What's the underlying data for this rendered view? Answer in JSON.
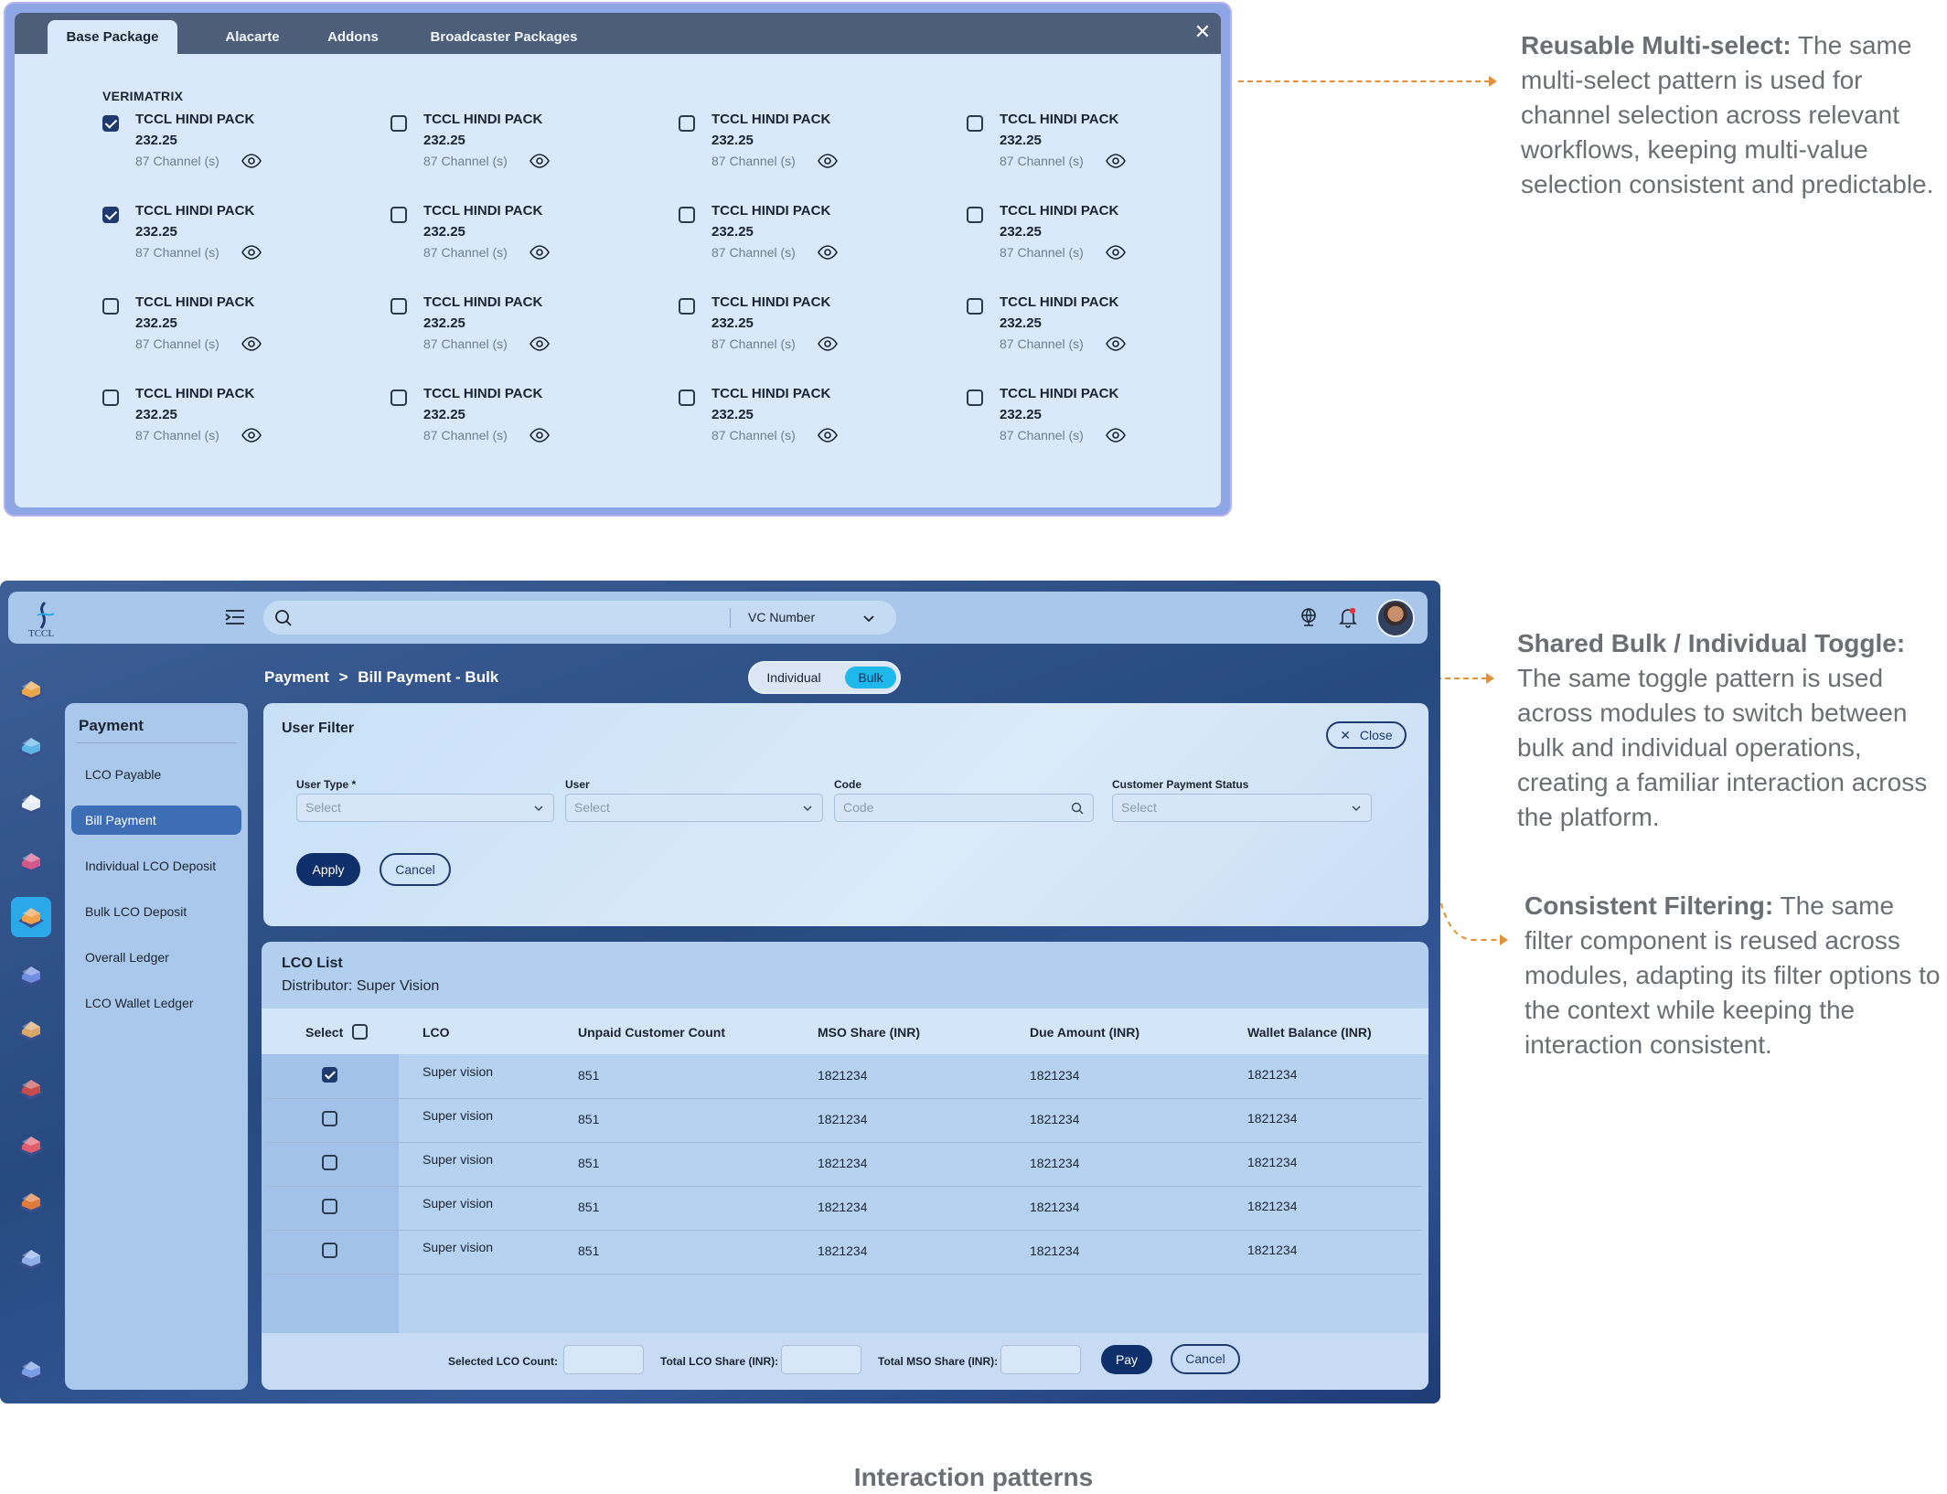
{
  "package_panel": {
    "tabs": [
      "Base Package",
      "Alacarte",
      "Addons",
      "Broadcaster Packages"
    ],
    "active_tab": 0,
    "close_icon": "close-icon",
    "vendor": "VERIMATRIX",
    "packs": [
      {
        "name": "TCCL HINDI PACK",
        "price": "232.25",
        "channels": "87 Channel (s)",
        "checked": true
      },
      {
        "name": "TCCL HINDI PACK",
        "price": "232.25",
        "channels": "87 Channel (s)",
        "checked": false
      },
      {
        "name": "TCCL HINDI PACK",
        "price": "232.25",
        "channels": "87 Channel (s)",
        "checked": false
      },
      {
        "name": "TCCL HINDI PACK",
        "price": "232.25",
        "channels": "87 Channel (s)",
        "checked": false
      },
      {
        "name": "TCCL HINDI PACK",
        "price": "232.25",
        "channels": "87 Channel (s)",
        "checked": true
      },
      {
        "name": "TCCL HINDI PACK",
        "price": "232.25",
        "channels": "87 Channel (s)",
        "checked": false
      },
      {
        "name": "TCCL HINDI PACK",
        "price": "232.25",
        "channels": "87 Channel (s)",
        "checked": false
      },
      {
        "name": "TCCL HINDI PACK",
        "price": "232.25",
        "channels": "87 Channel (s)",
        "checked": false
      },
      {
        "name": "TCCL HINDI PACK",
        "price": "232.25",
        "channels": "87 Channel (s)",
        "checked": false
      },
      {
        "name": "TCCL HINDI PACK",
        "price": "232.25",
        "channels": "87 Channel (s)",
        "checked": false
      },
      {
        "name": "TCCL HINDI PACK",
        "price": "232.25",
        "channels": "87 Channel (s)",
        "checked": false
      },
      {
        "name": "TCCL HINDI PACK",
        "price": "232.25",
        "channels": "87 Channel (s)",
        "checked": false
      },
      {
        "name": "TCCL HINDI PACK",
        "price": "232.25",
        "channels": "87 Channel (s)",
        "checked": false
      },
      {
        "name": "TCCL HINDI PACK",
        "price": "232.25",
        "channels": "87 Channel (s)",
        "checked": false
      },
      {
        "name": "TCCL HINDI PACK",
        "price": "232.25",
        "channels": "87 Channel (s)",
        "checked": false
      },
      {
        "name": "TCCL HINDI PACK",
        "price": "232.25",
        "channels": "87 Channel (s)",
        "checked": false
      }
    ]
  },
  "annotations": [
    {
      "title": "Reusable Multi-select:",
      "body": "The same multi-select pattern is used for channel selection across relevant workflows, keeping multi-value selection consistent and predictable."
    },
    {
      "title": "Shared Bulk / Individual Toggle:",
      "body": "The same toggle pattern is used across modules to switch between bulk and individual operations, creating a familiar interaction across the platform."
    },
    {
      "title": "Consistent Filtering:",
      "body": "The same filter component is reused across modules, adapting its filter options to the context while keeping the interaction consistent."
    }
  ],
  "caption": "Interaction patterns",
  "app": {
    "logo_text": "TCCL",
    "search": {
      "placeholder": "",
      "dropdown_value": "VC Number"
    },
    "header_icons": [
      "globe-icon",
      "bell-icon",
      "avatar"
    ],
    "rail_icons": [
      "house-icon",
      "user-icon",
      "card-icon",
      "person-icon",
      "payment-icon",
      "team-icon",
      "box-icon",
      "tv-icon",
      "offer-icon",
      "report-icon",
      "document-icon",
      "settings-icon"
    ],
    "active_rail_index": 4,
    "side_menu": {
      "title": "Payment",
      "items": [
        "LCO Payable",
        "Bill Payment",
        "Individual LCO Deposit",
        "Bulk LCO Deposit",
        "Overall Ledger",
        "LCO Wallet Ledger"
      ],
      "active_index": 1
    },
    "breadcrumb": {
      "parent": "Payment",
      "separator": ">",
      "current": "Bill Payment - Bulk"
    },
    "toggle": {
      "individual": "Individual",
      "bulk": "Bulk",
      "active": "Bulk"
    },
    "filter": {
      "title": "User Filter",
      "close_label": "Close",
      "fields": [
        {
          "label": "User Type *",
          "placeholder": "Select",
          "kind": "select"
        },
        {
          "label": "User",
          "placeholder": "Select",
          "kind": "select"
        },
        {
          "label": "Code",
          "placeholder": "Code",
          "kind": "search"
        },
        {
          "label": "Customer Payment Status",
          "placeholder": "Select",
          "kind": "select"
        }
      ],
      "apply_label": "Apply",
      "cancel_label": "Cancel"
    },
    "lco_list": {
      "title": "LCO List",
      "distributor_label": "Distributor:",
      "distributor_value": "Super Vision",
      "columns": [
        "Select",
        "LCO",
        "Unpaid Customer Count",
        "MSO Share (INR)",
        "Due Amount (INR)",
        "Wallet Balance (INR)"
      ],
      "rows": [
        {
          "checked": true,
          "lco": "Super vision",
          "unpaid": "851",
          "mso": "1821234",
          "due": "1821234",
          "wallet": "1821234"
        },
        {
          "checked": false,
          "lco": "Super vision",
          "unpaid": "851",
          "mso": "1821234",
          "due": "1821234",
          "wallet": "1821234"
        },
        {
          "checked": false,
          "lco": "Super vision",
          "unpaid": "851",
          "mso": "1821234",
          "due": "1821234",
          "wallet": "1821234"
        },
        {
          "checked": false,
          "lco": "Super vision",
          "unpaid": "851",
          "mso": "1821234",
          "due": "1821234",
          "wallet": "1821234"
        },
        {
          "checked": false,
          "lco": "Super vision",
          "unpaid": "851",
          "mso": "1821234",
          "due": "1821234",
          "wallet": "1821234"
        }
      ],
      "footer": {
        "selected_count_label": "Selected LCO Count:",
        "total_lco_label": "Total LCO Share (INR):",
        "total_mso_label": "Total MSO Share (INR):",
        "pay_label": "Pay",
        "cancel_label": "Cancel"
      }
    }
  },
  "colors": {
    "accent": "#1fb8ea",
    "primary": "#0f2f6b",
    "annotation_arrow": "#e2913a"
  }
}
